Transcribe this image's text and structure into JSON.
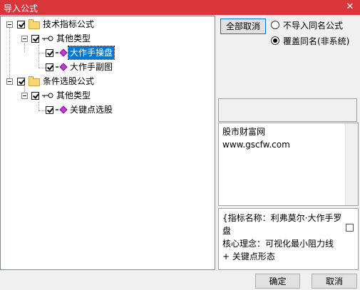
{
  "window": {
    "title": "导入公式",
    "close_glyph": "✕"
  },
  "tree": {
    "group1": {
      "label": "技术指标公式",
      "type_label": "其他类型",
      "items": [
        "大作手操盘",
        "大作手副图"
      ]
    },
    "group2": {
      "label": "条件选股公式",
      "type_label": "其他类型",
      "items": [
        "关键点选股"
      ]
    },
    "selected": "大作手操盘"
  },
  "controls": {
    "select_all_label": "全部取消",
    "options": [
      "不导入同名公式",
      "覆盖同名(非系统)"
    ],
    "selected_option": "覆盖同名(非系统)"
  },
  "info_box": {
    "lines": [
      "股市财富网",
      "www.gscfw.com"
    ]
  },
  "desc_box": {
    "lines": [
      "{指标名称：利弗莫尔·大作手罗",
      "盘",
      "核心理念：可视化最小阻力线",
      "+ 关键点形态"
    ]
  },
  "footer": {
    "ok_label": "确定",
    "cancel_label": "取消"
  },
  "icons": {
    "folder": "folder-icon",
    "key": "key-icon",
    "formula": "formula-diamond-icon",
    "checkbox": "checkbox-icon",
    "expander": "collapse-icon"
  },
  "colors": {
    "titlebar": "#d9363c",
    "selection": "#0078d7",
    "folder": "#f7d774",
    "formula_icon": "#c83ad8"
  }
}
